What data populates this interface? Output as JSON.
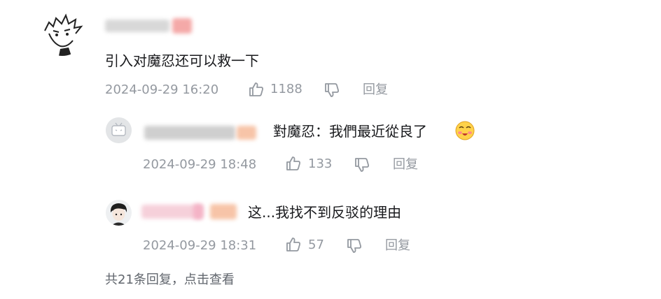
{
  "comment": {
    "text": "引入对魔忍还可以救一下",
    "time": "2024-09-29 16:20",
    "likes": "1188",
    "reply_label": "回复"
  },
  "replies": [
    {
      "text": "對魔忍：我們最近從良了",
      "emoji": "emoji-face-icon",
      "time": "2024-09-29 18:48",
      "likes": "133",
      "reply_label": "回复"
    },
    {
      "text": "这...我找不到反驳的理由",
      "time": "2024-09-29 18:31",
      "likes": "57",
      "reply_label": "回复"
    }
  ],
  "more_replies": "共21条回复，点击查看",
  "colors": {
    "meta": "#9499a0",
    "text": "#18191c",
    "pink": "#f6b8c4",
    "peach": "#f7c4a8"
  }
}
